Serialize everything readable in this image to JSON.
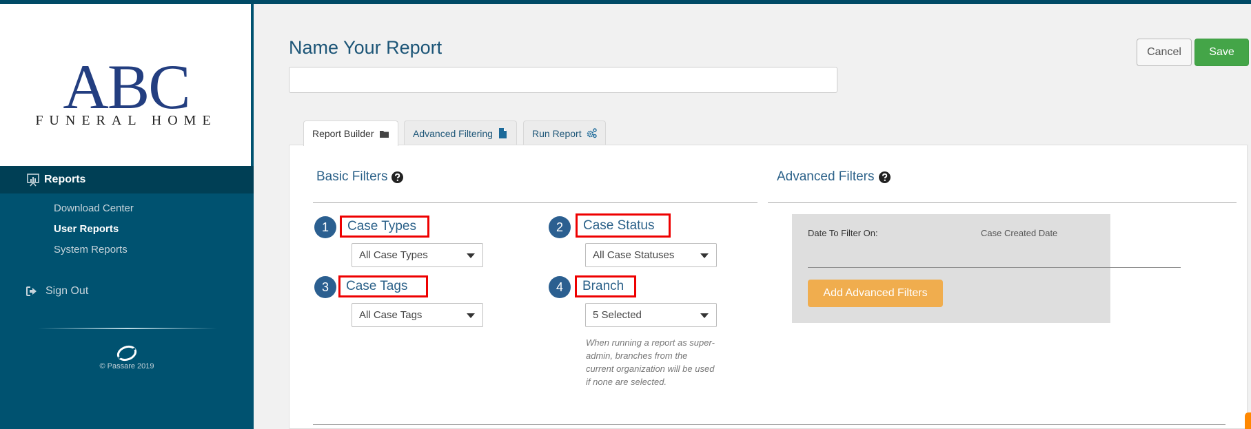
{
  "brand": {
    "logo_main": "ABC",
    "logo_sub": "Funeral Home",
    "copyright": "© Passare 2019"
  },
  "sidebar": {
    "section_label": "Reports",
    "items": [
      {
        "label": "Download Center",
        "active": false
      },
      {
        "label": "User Reports",
        "active": true
      },
      {
        "label": "System Reports",
        "active": false
      }
    ],
    "sign_out_label": "Sign Out"
  },
  "header": {
    "title": "Name Your Report",
    "name_input_value": "",
    "cancel_label": "Cancel",
    "save_label": "Save"
  },
  "tabs": [
    {
      "label": "Report Builder",
      "icon": "folder-icon",
      "active": true
    },
    {
      "label": "Advanced Filtering",
      "icon": "file-icon",
      "active": false
    },
    {
      "label": "Run Report",
      "icon": "gears-icon",
      "active": false
    }
  ],
  "basic_filters": {
    "title": "Basic Filters",
    "filters": [
      {
        "number": "1",
        "label": "Case Types",
        "selected": "All Case Types"
      },
      {
        "number": "2",
        "label": "Case Status",
        "selected": "All Case Statuses"
      },
      {
        "number": "3",
        "label": "Case Tags",
        "selected": "All Case Tags"
      },
      {
        "number": "4",
        "label": "Branch",
        "selected": "5 Selected"
      }
    ],
    "branch_hint": "When running a report as super-admin, branches from the current organization will be used if none are selected."
  },
  "advanced_filters": {
    "title": "Advanced Filters",
    "date_filter_label": "Date To Filter On:",
    "date_filter_value": "Case Created Date",
    "add_button_label": "Add Advanced Filters"
  },
  "colors": {
    "sidebar": "#005270",
    "sidebar_active": "#003f55",
    "accent": "#2b6189",
    "save": "#44a548",
    "add_filters": "#f0ad4e",
    "highlight_box": "#ee0000"
  }
}
